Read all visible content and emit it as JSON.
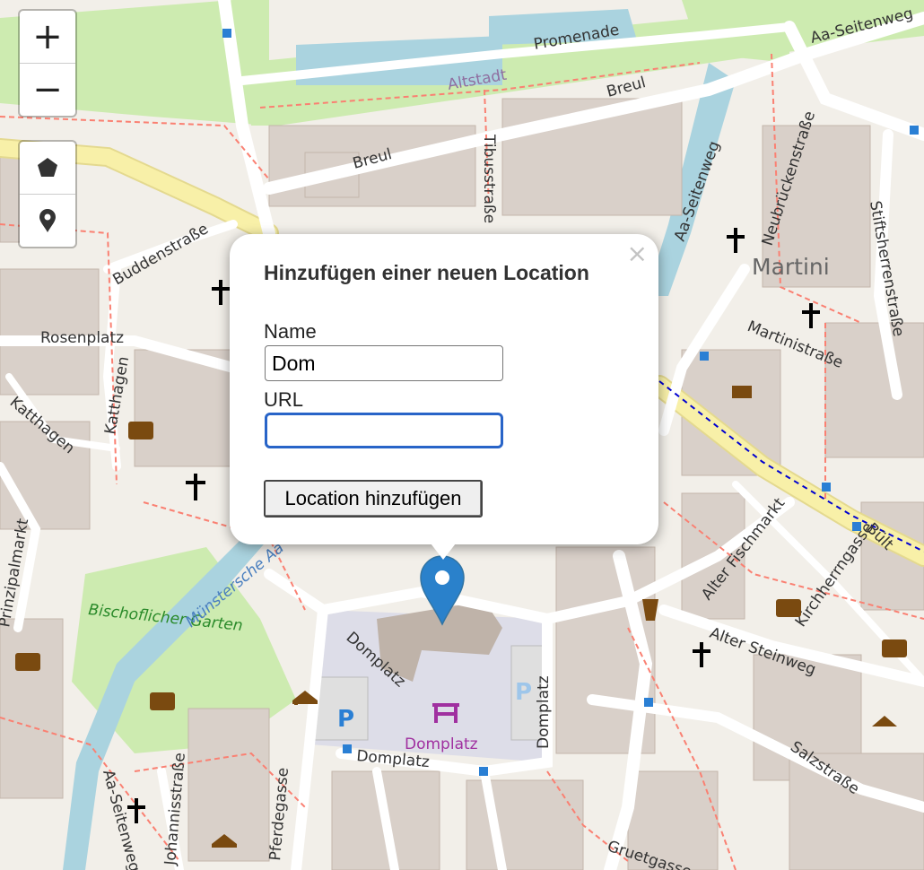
{
  "map": {
    "street_labels": [
      "Promenade",
      "Aa-Seitenweg",
      "Altstadt",
      "Breul",
      "Breul",
      "Tibusstraße",
      "Neubrückenstraße",
      "Stiftsherrenstraße",
      "Martini",
      "Martinistraße",
      "Buddenstraße",
      "Rosenplatz",
      "Katthagen",
      "Katthagen",
      "Aa-Seitenweg",
      "Bischoflicher Garten",
      "Münstersche Aa",
      "Domplatz",
      "Domplatz",
      "Domplatz",
      "Domplatz",
      "Alter Fischmarkt",
      "Kirchherrngasse",
      "Alter Steinweg",
      "Salzstraße",
      "Bült",
      "Pferdegasse",
      "Johannisstraße",
      "Aa-Seitenweg",
      "Gruetgasse",
      "Prinzipalmarkt"
    ],
    "colors": {
      "background": "#f2efe9",
      "building": "#d9d0c9",
      "park": "#c8facc",
      "road": "#ffffff",
      "primary_road": "#f8f0a8",
      "water": "#aad3df",
      "footway": "#fa8072",
      "square": "#dddde8"
    }
  },
  "controls": {
    "zoom_in_label": "+",
    "zoom_out_label": "−",
    "polygon_icon": "pentagon-icon",
    "marker_icon": "map-pin-icon"
  },
  "popup": {
    "close_label": "×",
    "title": "Hinzufügen einer neuen Location",
    "name_label": "Name",
    "name_value": "Dom",
    "url_label": "URL",
    "url_value": "",
    "submit_label": "Location hinzufügen"
  },
  "marker": {
    "icon": "map-marker-icon",
    "color": "#2a81cb"
  }
}
